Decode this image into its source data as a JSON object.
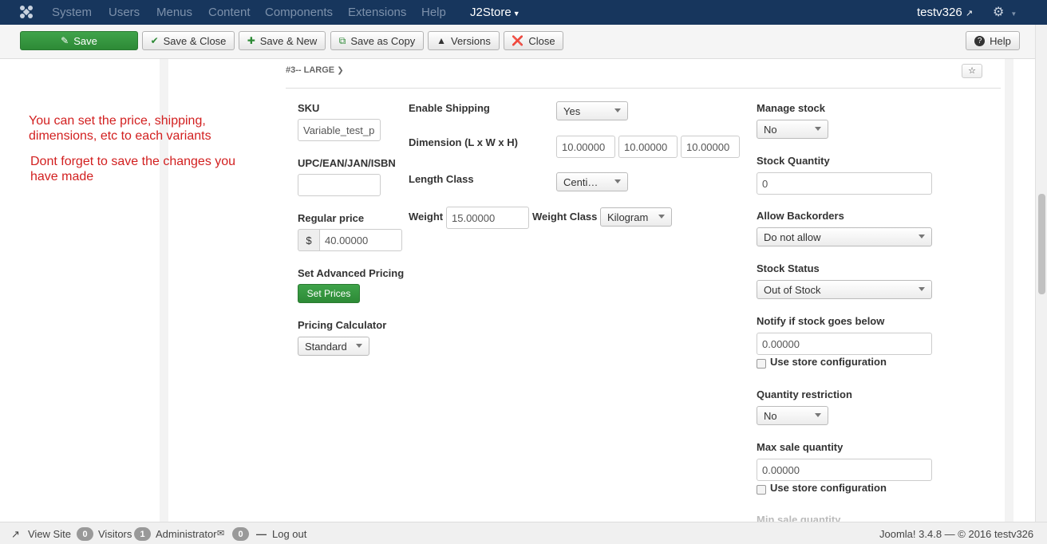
{
  "topnav": {
    "menu": [
      "System",
      "Users",
      "Menus",
      "Content",
      "Components",
      "Extensions",
      "Help"
    ],
    "component": "J2Store",
    "user": "testv326"
  },
  "toolbar": {
    "save": "Save",
    "save_close": "Save & Close",
    "save_new": "Save & New",
    "save_copy": "Save as Copy",
    "versions": "Versions",
    "close": "Close",
    "help": "Help"
  },
  "variant": {
    "heading": "#3-- LARGE"
  },
  "notes": {
    "line1": "You can set the price, shipping,",
    "line2": "dimensions, etc to each variants",
    "line3": "Dont forget to save the changes you",
    "line4": "have made"
  },
  "form": {
    "sku_label": "SKU",
    "sku_value": "Variable_test_p",
    "upc_label": "UPC/EAN/JAN/ISBN",
    "upc_value": "",
    "regular_price_label": "Regular price",
    "currency_symbol": "$",
    "regular_price_value": "40.00000",
    "advanced_pricing_label": "Set Advanced Pricing",
    "set_prices_button": "Set Prices",
    "pricing_calculator_label": "Pricing Calculator",
    "pricing_calculator_value": "Standard",
    "enable_shipping_label": "Enable Shipping",
    "enable_shipping_value": "Yes",
    "dimension_label": "Dimension (L x W x H)",
    "length_value": "10.00000",
    "width_value": "10.00000",
    "height_value": "10.00000",
    "length_class_label": "Length Class",
    "length_class_value": "Centi…",
    "weight_label": "Weight",
    "weight_value": "15.00000",
    "weight_class_label": "Weight Class",
    "weight_class_value": "Kilogram",
    "manage_stock_label": "Manage stock",
    "manage_stock_value": "No",
    "stock_quantity_label": "Stock Quantity",
    "stock_quantity_value": "0",
    "allow_backorders_label": "Allow Backorders",
    "allow_backorders_value": "Do not allow",
    "stock_status_label": "Stock Status",
    "stock_status_value": "Out of Stock",
    "notify_label": "Notify if stock goes below",
    "notify_value": "0.00000",
    "use_store_config_1": "Use store configuration",
    "quantity_restriction_label": "Quantity restriction",
    "quantity_restriction_value": "No",
    "max_sale_label": "Max sale quantity",
    "max_sale_value": "0.00000",
    "use_store_config_2": "Use store configuration",
    "min_sale_label": "Min sale quantity"
  },
  "footer": {
    "view_site": "View Site",
    "visitors_count": "0",
    "visitors_label": "Visitors",
    "admin_count": "1",
    "admin_label": "Administrator",
    "messages_count": "0",
    "logout": "Log out",
    "version": "Joomla! 3.4.8 — © 2016 testv326"
  },
  "colors": {
    "navbar": "#17365d",
    "primary_green": "#3fa34a",
    "note_red": "#d21f1f"
  }
}
